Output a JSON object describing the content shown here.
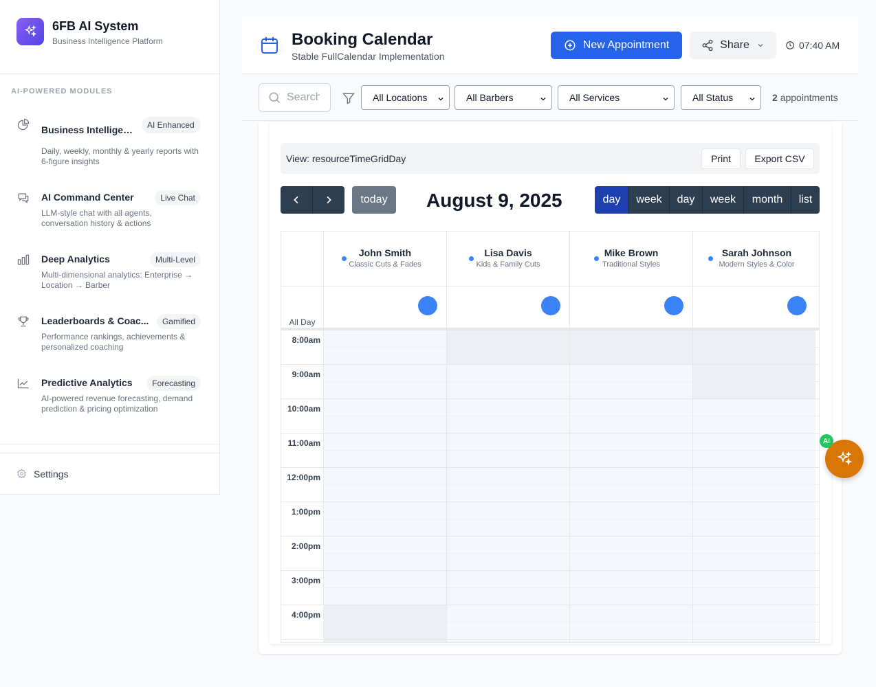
{
  "brand": {
    "title": "6FB AI System",
    "subtitle": "Business Intelligence Platform"
  },
  "sidebar": {
    "section_label": "AI-POWERED MODULES",
    "modules": [
      {
        "title": "Business Intelligen...",
        "badge": "AI Enhanced",
        "desc": "Daily, weekly, monthly & yearly reports with 6-figure insights",
        "icon": "pie-chart-icon"
      },
      {
        "title": "AI Command Center",
        "badge": "Live Chat",
        "desc": "LLM-style chat with all agents, conversation history & actions",
        "icon": "chat-icon"
      },
      {
        "title": "Deep Analytics",
        "badge": "Multi-Level",
        "desc": "Multi-dimensional analytics: Enterprise → Location → Barber",
        "icon": "bar-chart-icon"
      },
      {
        "title": "Leaderboards & Coac...",
        "badge": "Gamified",
        "desc": "Performance rankings, achievements & personalized coaching",
        "icon": "trophy-icon"
      },
      {
        "title": "Predictive Analytics",
        "badge": "Forecasting",
        "desc": "AI-powered revenue forecasting, demand prediction & pricing optimization",
        "icon": "trend-chart-icon"
      }
    ],
    "settings_label": "Settings"
  },
  "header": {
    "title": "Booking Calendar",
    "subtitle": "Stable FullCalendar Implementation",
    "new_button": "New Appointment",
    "share_button": "Share",
    "time": "07:40 AM"
  },
  "filters": {
    "search_placeholder": "Search",
    "locations": "All Locations",
    "barbers": "All Barbers",
    "services": "All Services",
    "status": "All Status",
    "count_number": "2",
    "count_label": "appointments"
  },
  "calendar": {
    "view_text": "View: resourceTimeGridDay",
    "print": "Print",
    "export": "Export CSV",
    "today": "today",
    "date": "August 9, 2025",
    "views": [
      "day",
      "week",
      "day",
      "week",
      "month",
      "list"
    ],
    "all_day": "All Day",
    "resources": [
      {
        "name": "John Smith",
        "specialty": "Classic Cuts & Fades"
      },
      {
        "name": "Lisa Davis",
        "specialty": "Kids & Family Cuts"
      },
      {
        "name": "Mike Brown",
        "specialty": "Traditional Styles"
      },
      {
        "name": "Sarah Johnson",
        "specialty": "Modern Styles & Color"
      }
    ],
    "times": [
      "8:00am",
      "9:00am",
      "10:00am",
      "11:00am",
      "12:00pm",
      "1:00pm",
      "2:00pm",
      "3:00pm",
      "4:00pm"
    ]
  },
  "ai_fab": {
    "badge": "AI"
  },
  "colors": {
    "primary": "#2563eb",
    "brand_gradient_start": "#8b5cf6",
    "fab": "#d97706",
    "badge": "#22c55e",
    "calendar_dark": "#2c3e50",
    "calendar_active": "#1e40af"
  }
}
